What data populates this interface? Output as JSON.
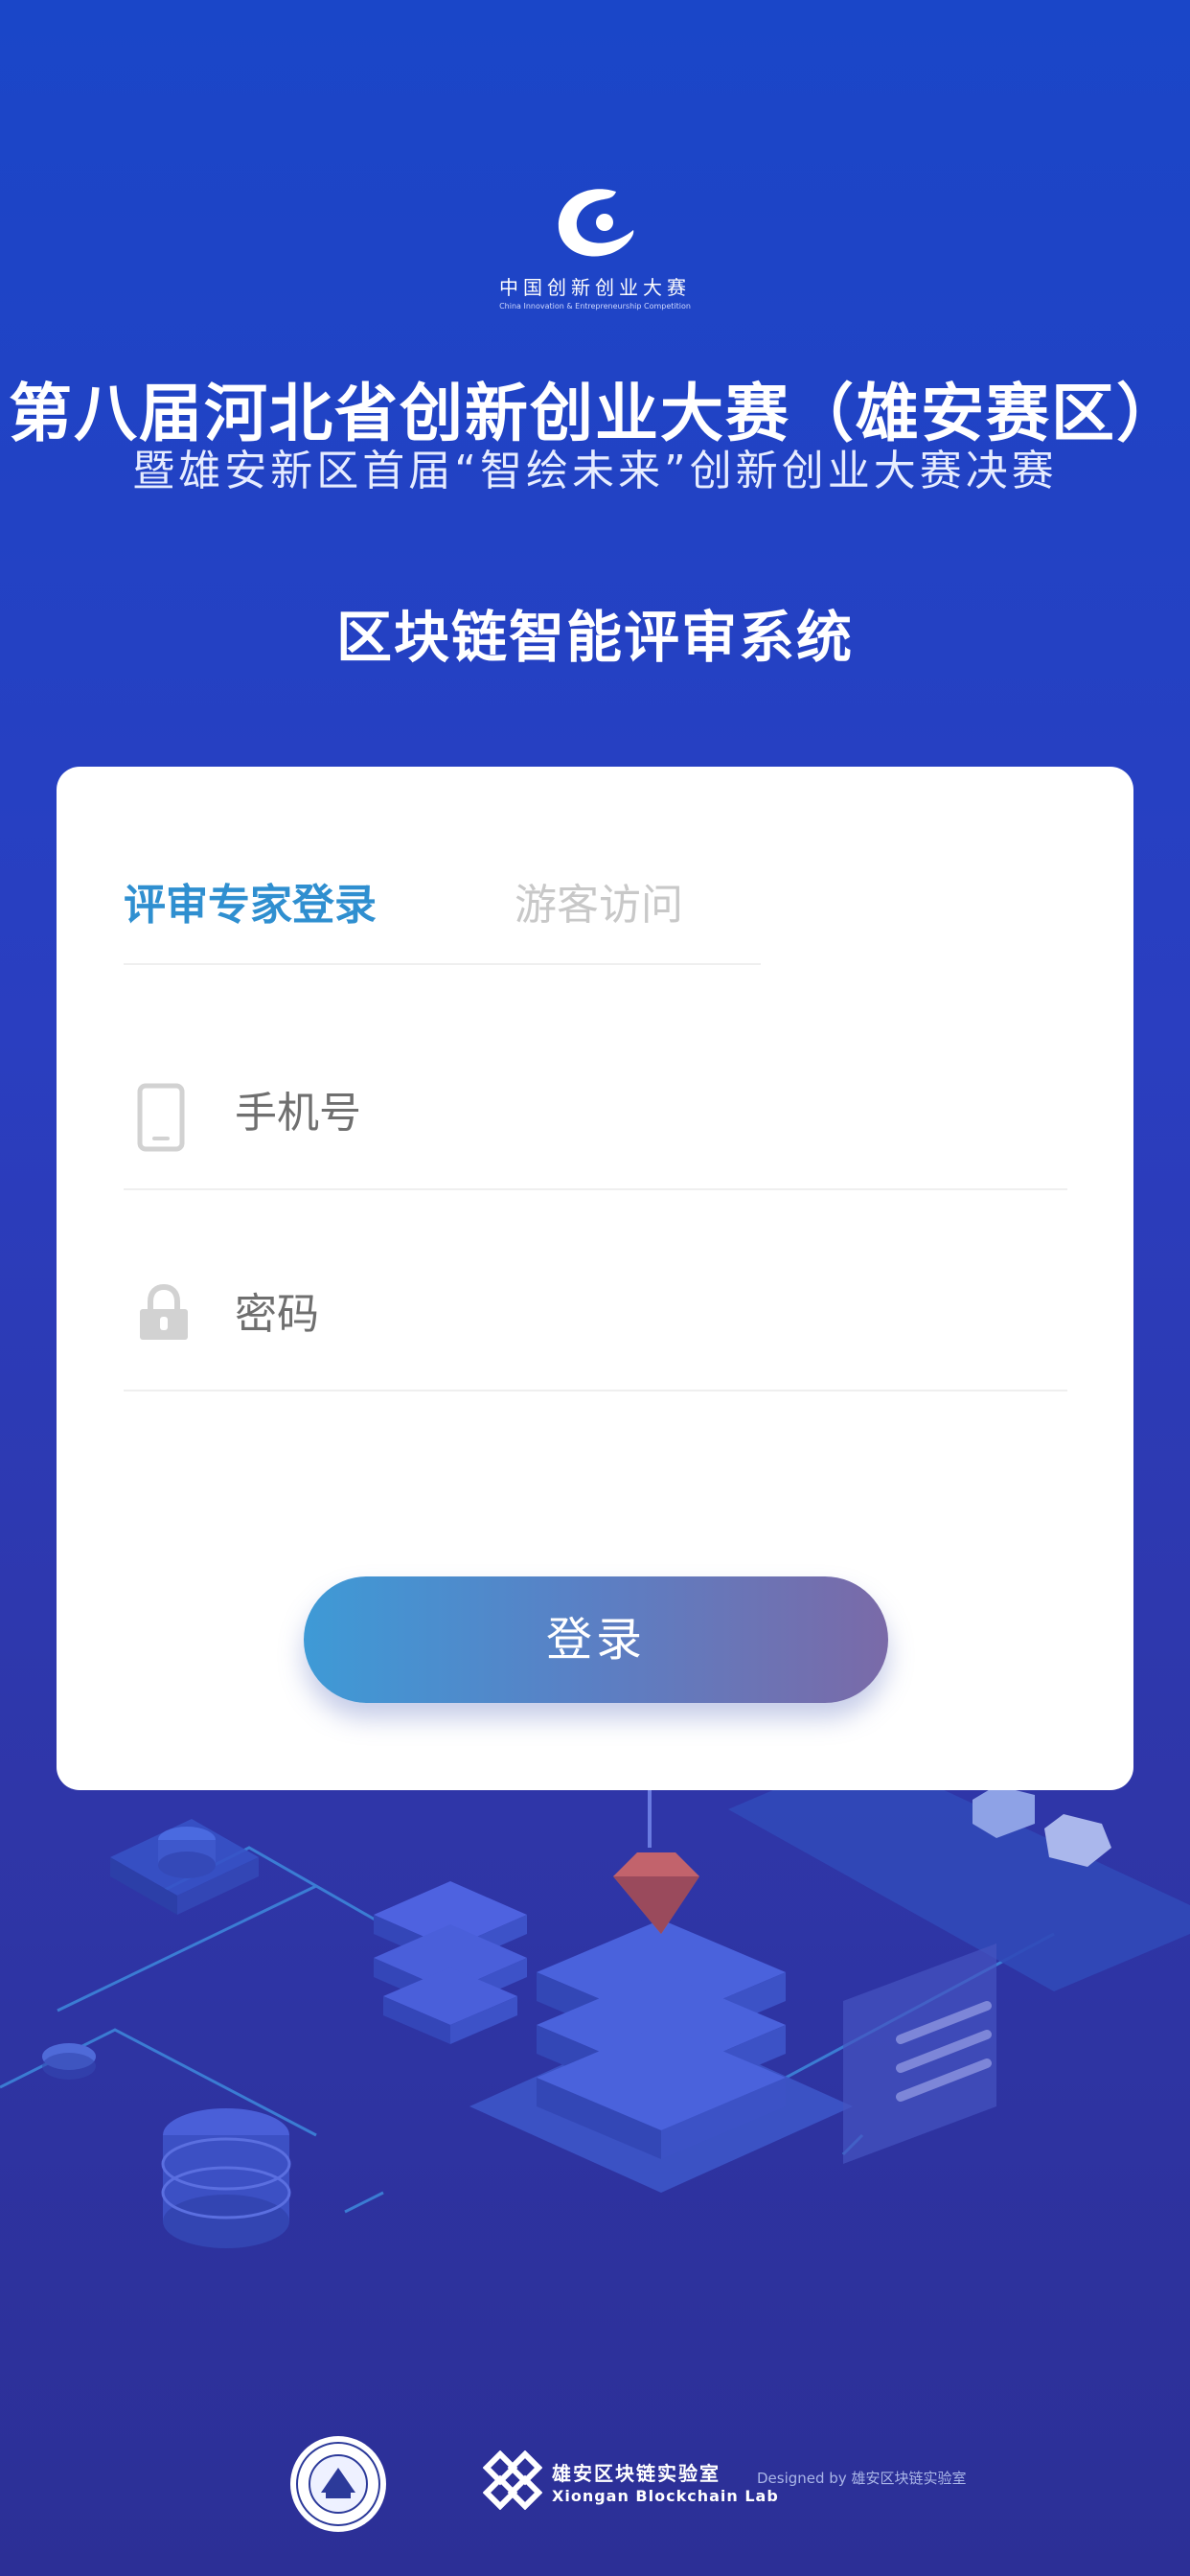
{
  "brand": {
    "logo_cn": "中国创新创业大赛",
    "logo_en": "China Innovation & Entrepreneurship Competition"
  },
  "header": {
    "title": "第八届河北省创新创业大赛（雄安赛区）",
    "subtitle": "暨雄安新区首届“智绘未来”创新创业大赛决赛",
    "system_title": "区块链智能评审系统"
  },
  "login": {
    "tabs": [
      {
        "label": "评审专家登录",
        "active": true
      },
      {
        "label": "游客访问",
        "active": false
      }
    ],
    "phone_placeholder": "手机号",
    "password_placeholder": "密码",
    "submit_label": "登录",
    "accent_color": "#2f8fd0"
  },
  "footer": {
    "lab_cn": "雄安区块链实验室",
    "lab_en": "Xiongan Blockchain Lab",
    "designed_by": "Designed by 雄安区块链实验室"
  },
  "icons": [
    "logo-c-icon",
    "phone-icon",
    "lock-icon",
    "seal-icon",
    "blockchain-lab-logo-icon"
  ]
}
